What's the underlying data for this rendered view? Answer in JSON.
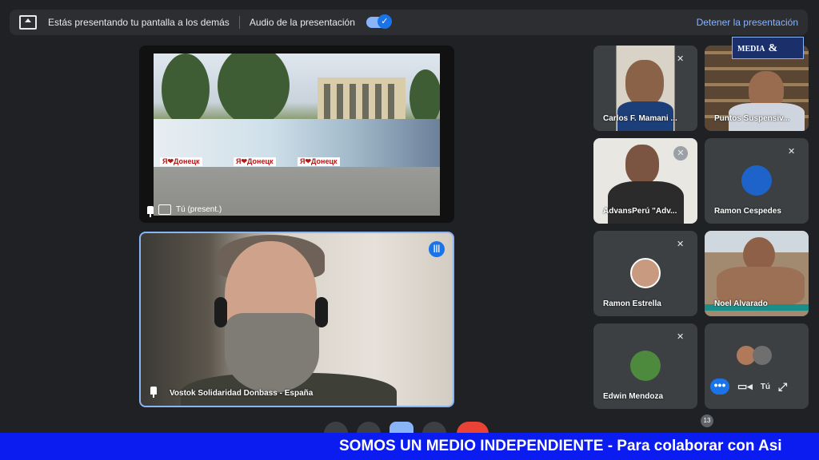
{
  "topbar": {
    "presenting_message": "Estás presentando tu pantalla a los demás",
    "audio_label": "Audio de la presentación",
    "stop_label": "Detener la presentación"
  },
  "presentation": {
    "label": "Tú (present.)",
    "mural_words": [
      "Я❤Донецк",
      "Я❤Донецк",
      "Я❤Донецк"
    ]
  },
  "speaker": {
    "name": "Vostok Solidaridad Donbass - España"
  },
  "participants": [
    {
      "name": "Carlos F. Mamani ...",
      "muted": true
    },
    {
      "name": "Puntos Suspensiv...",
      "muted": false
    },
    {
      "name": "AdvansPerú \"Adv...",
      "muted": true
    },
    {
      "name": "Ramon Cespedes",
      "muted": true
    },
    {
      "name": "Ramon Estrella",
      "muted": true
    },
    {
      "name": "Noel Alvarado",
      "muted": false
    },
    {
      "name": "Edwin Mendoza",
      "muted": true
    },
    {
      "name": "",
      "muted": false
    }
  ],
  "self_tile": {
    "label": "Tú"
  },
  "participant_count": "13",
  "ticker": {
    "text": "SOMOS UN MEDIO INDEPENDIENTE - Para colaborar con Asi"
  },
  "logo_text": "&",
  "colors": {
    "accent": "#1a73e8",
    "ticker_bg": "#0b1cf0",
    "hangup": "#ea4335"
  }
}
